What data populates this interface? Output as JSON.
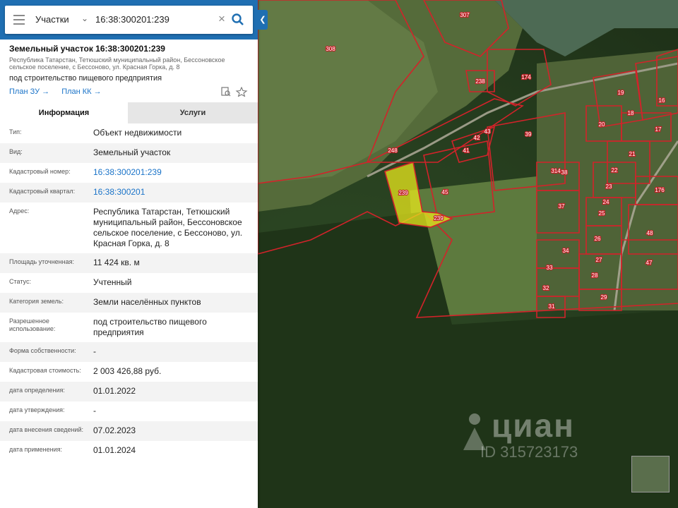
{
  "search": {
    "category": "Участки",
    "query": "16:38:300201:239"
  },
  "parcel": {
    "title": "Земельный участок 16:38:300201:239",
    "address_short": "Республика Татарстан, Тетюшский муниципальный район, Бессоновское сельское поселение, с Бессоново, ул. Красная Горка, д. 8",
    "use": "под строительство пищевого предприятия",
    "link_plan_zu": "План ЗУ →",
    "link_plan_kk": "План КК →"
  },
  "tabs": {
    "info": "Информация",
    "services": "Услуги"
  },
  "details": [
    {
      "label": "Тип:",
      "value": "Объект недвижимости"
    },
    {
      "label": "Вид:",
      "value": "Земельный участок"
    },
    {
      "label": "Кадастровый номер:",
      "value": "16:38:300201:239"
    },
    {
      "label": "Кадастровый квартал:",
      "value": "16:38:300201"
    },
    {
      "label": "Адрес:",
      "value": "Республика Татарстан, Тетюшский муниципальный район, Бессоновское сельское поселение, с Бессоново, ул. Красная Горка, д. 8"
    },
    {
      "label": "Площадь уточненная:",
      "value": "11 424 кв. м"
    },
    {
      "label": "Статус:",
      "value": "Учтенный"
    },
    {
      "label": "Категория земель:",
      "value": "Земли населённых пунктов"
    },
    {
      "label": "Разрешенное использование:",
      "value": "под строительство пищевого предприятия"
    },
    {
      "label": "Форма собственности:",
      "value": "-"
    },
    {
      "label": "Кадастровая стоимость:",
      "value": "2 003 426,88 руб."
    },
    {
      "label": "дата определения:",
      "value": "01.01.2022"
    },
    {
      "label": "дата утверждения:",
      "value": "-"
    },
    {
      "label": "дата внесения сведений:",
      "value": "07.02.2023"
    },
    {
      "label": "дата применения:",
      "value": "01.01.2024"
    }
  ],
  "map": {
    "parcel_labels": [
      "307",
      "308",
      "238",
      "174",
      "19",
      "16",
      "18",
      "20",
      "17",
      "39",
      "248",
      "21",
      "22",
      "314",
      "38",
      "23",
      "176",
      "37",
      "24",
      "25",
      "239",
      "45",
      "43",
      "42",
      "41",
      "26",
      "48",
      "27",
      "33",
      "28",
      "47",
      "32",
      "29",
      "31",
      "34"
    ],
    "selected_label": "239",
    "watermark": "циан",
    "watermark_id": "ID 315723173"
  },
  "colors": {
    "accent": "#1f6fb2",
    "link": "#1a73c8",
    "boundary": "#d2232a",
    "selected_fill": "#e8e81c"
  }
}
